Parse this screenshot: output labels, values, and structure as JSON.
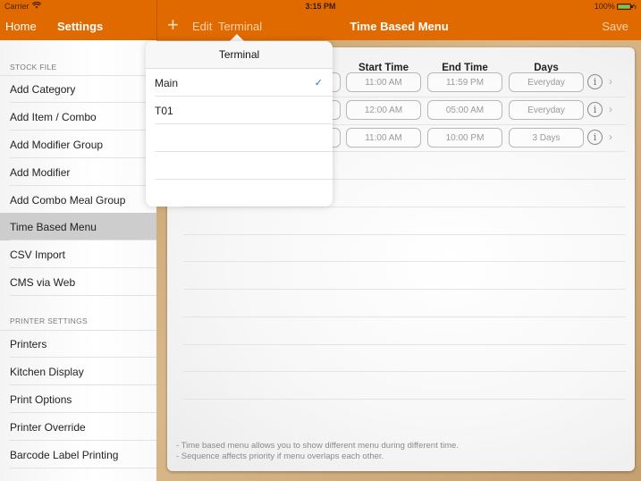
{
  "status_bar": {
    "carrier": "Carrier",
    "time": "3:15 PM",
    "battery_percent": "100%",
    "battery_level": 1.0
  },
  "nav": {
    "home_label": "Home",
    "settings_label": "Settings",
    "add_icon": "+",
    "edit_label": "Edit",
    "terminal_label": "Terminal",
    "title": "Time Based Menu",
    "save_label": "Save"
  },
  "sidebar": {
    "sections": [
      {
        "header": "STOCK FILE",
        "items": [
          {
            "label": "Add Category"
          },
          {
            "label": "Add Item / Combo"
          },
          {
            "label": "Add Modifier Group"
          },
          {
            "label": "Add Modifier"
          },
          {
            "label": "Add Combo Meal Group"
          },
          {
            "label": "Time Based Menu",
            "active": true
          },
          {
            "label": "CSV Import"
          },
          {
            "label": "CMS via Web"
          }
        ]
      },
      {
        "header": "PRINTER SETTINGS",
        "items": [
          {
            "label": "Printers"
          },
          {
            "label": "Kitchen Display"
          },
          {
            "label": "Print Options"
          },
          {
            "label": "Printer Override"
          },
          {
            "label": "Barcode Label Printing"
          }
        ]
      }
    ]
  },
  "table": {
    "columns": [
      "Start Time",
      "End Time",
      "Days"
    ],
    "rows": [
      {
        "start": "11:00 AM",
        "end": "11:59 PM",
        "days": "Everyday"
      },
      {
        "start": "12:00 AM",
        "end": "05:00 AM",
        "days": "Everyday"
      },
      {
        "start": "11:00 AM",
        "end": "10:00 PM",
        "days": "3 Days"
      }
    ],
    "info_icon": "i",
    "chevron_icon": "›"
  },
  "notes": [
    "- Time based menu allows you to show different menu during different time.",
    "- Sequence affects priority if menu overlaps each other."
  ],
  "popover": {
    "title": "Terminal",
    "options": [
      {
        "label": "Main",
        "selected": true
      },
      {
        "label": "T01",
        "selected": false
      },
      {
        "label": "",
        "selected": false
      },
      {
        "label": "",
        "selected": false
      },
      {
        "label": "",
        "selected": false
      }
    ],
    "check_icon": "✓"
  },
  "colors": {
    "nav_orange": "#e06a00",
    "check_blue": "#1a73e8",
    "battery_green": "#4cd964"
  }
}
